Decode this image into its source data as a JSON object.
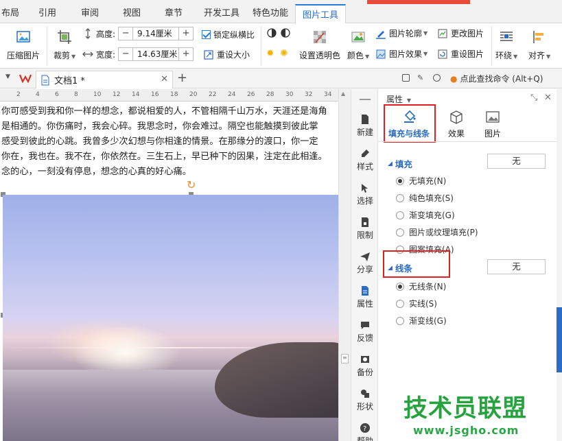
{
  "colors": {
    "accent": "#2b6cc4",
    "highlight": "#e02020",
    "watermark": "#26a33f"
  },
  "tabs": [
    "布局",
    "引用",
    "审阅",
    "视图",
    "章节",
    "开发工具",
    "特色功能",
    "图片工具"
  ],
  "active_tab": "图片工具",
  "ribbon": {
    "compress": "压缩图片",
    "crop": "裁剪",
    "height_label": "高度:",
    "height_value": "9.14厘米",
    "width_label": "宽度:",
    "width_value": "14.63厘米",
    "lock_ratio": "锁定纵横比",
    "reset_size": "重设大小",
    "transparent": "设置透明色",
    "color": "颜色",
    "outline": "图片轮廓",
    "effect": "图片效果",
    "change": "更改图片",
    "reset_pic": "重设图片",
    "wrap": "环绕",
    "align": "对齐"
  },
  "docbar": {
    "doc_title": "文档1 *",
    "search_hint": "点此查找命令 (Alt+Q)"
  },
  "ruler": [
    "2",
    "4",
    "6",
    "8",
    "10",
    "12",
    "14",
    "16",
    "18",
    "20",
    "22",
    "24",
    "26",
    "28",
    "30",
    "32",
    "34"
  ],
  "document": {
    "lines": [
      "你可感受到我和你一样的想念，都说相爱的人，不管相隔千山万水，天涯还是海角",
      "是相通的。你伤痛时，我会心碎。我思念时，你会难过。隔空也能触摸到彼此掌",
      "感受到彼此的心跳。我曾多少次幻想与你相逢的情景。在那缘分的渡口，你一定",
      "你在，我也在。我不在，你依然在。三生石上，早已种下的因果，注定在此相逢。",
      "念的心，一刻没有停息，想念的心真的好心痛。"
    ]
  },
  "sidebar": [
    "新建",
    "样式",
    "选择",
    "限制",
    "分享",
    "属性",
    "反馈",
    "备份",
    "形状",
    "帮助"
  ],
  "panel": {
    "title": "属性",
    "tabs": [
      "填充与线条",
      "效果",
      "图片"
    ],
    "fill_section": "填充",
    "fill_button": "无",
    "fill_options": [
      "无填充(N)",
      "纯色填充(S)",
      "渐变填充(G)",
      "图片或纹理填充(P)",
      "图案填充(A)"
    ],
    "fill_selected": 0,
    "line_section": "线条",
    "line_button": "无",
    "line_options": [
      "无线条(N)",
      "实线(S)",
      "渐变线(G)"
    ],
    "line_selected": 0
  },
  "watermark": {
    "main": "技术员联盟",
    "sub": "www.jsgho.com"
  }
}
